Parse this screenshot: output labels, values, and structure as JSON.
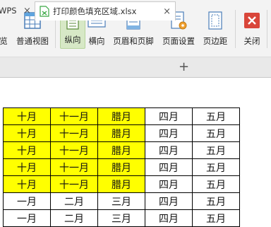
{
  "ribbon": {
    "buttons": [
      {
        "label": "览",
        "icon": "preview-icon"
      },
      {
        "label": "普通视图",
        "icon": "normal-view-icon"
      },
      {
        "label": "纵向",
        "icon": "portrait-icon",
        "active": true
      },
      {
        "label": "横向",
        "icon": "landscape-icon"
      },
      {
        "label": "页眉和页脚",
        "icon": "header-footer-icon"
      },
      {
        "label": "页面设置",
        "icon": "page-setup-icon"
      },
      {
        "label": "页边距",
        "icon": "margins-icon"
      },
      {
        "label": "关闭",
        "icon": "close-icon"
      }
    ]
  },
  "tabs": {
    "items": [
      {
        "label": "WPS",
        "close": "×"
      },
      {
        "label": "打印颜色填充区域.xlsx",
        "close": "×"
      }
    ],
    "add": "+"
  },
  "sheet": {
    "rows": [
      [
        "十月",
        "十一月",
        "腊月",
        "四月",
        "五月"
      ],
      [
        "十月",
        "十一月",
        "腊月",
        "四月",
        "五月"
      ],
      [
        "十月",
        "十一月",
        "腊月",
        "四月",
        "五月"
      ],
      [
        "十月",
        "十一月",
        "腊月",
        "四月",
        "五月"
      ],
      [
        "十月",
        "十一月",
        "腊月",
        "四月",
        "五月"
      ],
      [
        "一月",
        "二月",
        "三月",
        "四月",
        "五月"
      ],
      [
        "一月",
        "二月",
        "三月",
        "四月",
        "五月"
      ]
    ],
    "highlight_color": "#ffff00"
  },
  "colors": {
    "ribbon_bg": "#f3f3f3",
    "active_button_bg": "#d7e8c6",
    "close_red": "#d9463a",
    "sheet_icon_green": "#3aa845"
  }
}
